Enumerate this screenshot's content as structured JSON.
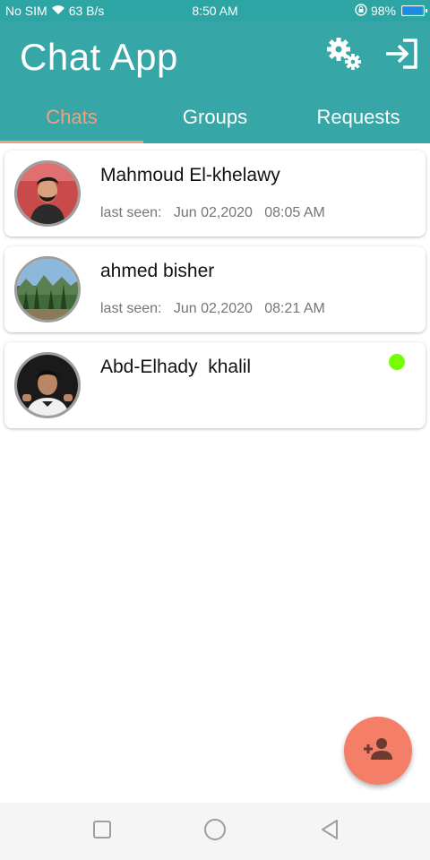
{
  "status_bar": {
    "carrier": "No SIM",
    "speed": "63 B/s",
    "time": "8:50 AM",
    "battery": "98%",
    "battery_level": 0.98
  },
  "app_bar": {
    "title": "Chat App",
    "settings_icon": "settings-gears-icon",
    "logout_icon": "logout-arrow-icon"
  },
  "tabs": [
    {
      "label": "Chats",
      "active": true
    },
    {
      "label": "Groups",
      "active": false
    },
    {
      "label": "Requests",
      "active": false
    }
  ],
  "chats": [
    {
      "name": "Mahmoud El-khelawy",
      "last_seen_label": "last seen:",
      "date": "Jun 02,2020",
      "time": "08:05 AM",
      "online": false
    },
    {
      "name": "ahmed bisher",
      "last_seen_label": "last seen:",
      "date": "Jun 02,2020",
      "time": "08:21 AM",
      "online": false
    },
    {
      "name": "Abd-Elhady  khalil",
      "online": true
    }
  ],
  "fab": {
    "icon": "add-person-icon"
  },
  "colors": {
    "primary": "#37a6a6",
    "accent": "#f4a07f",
    "fab": "#f47e68",
    "online": "#76ff03"
  }
}
